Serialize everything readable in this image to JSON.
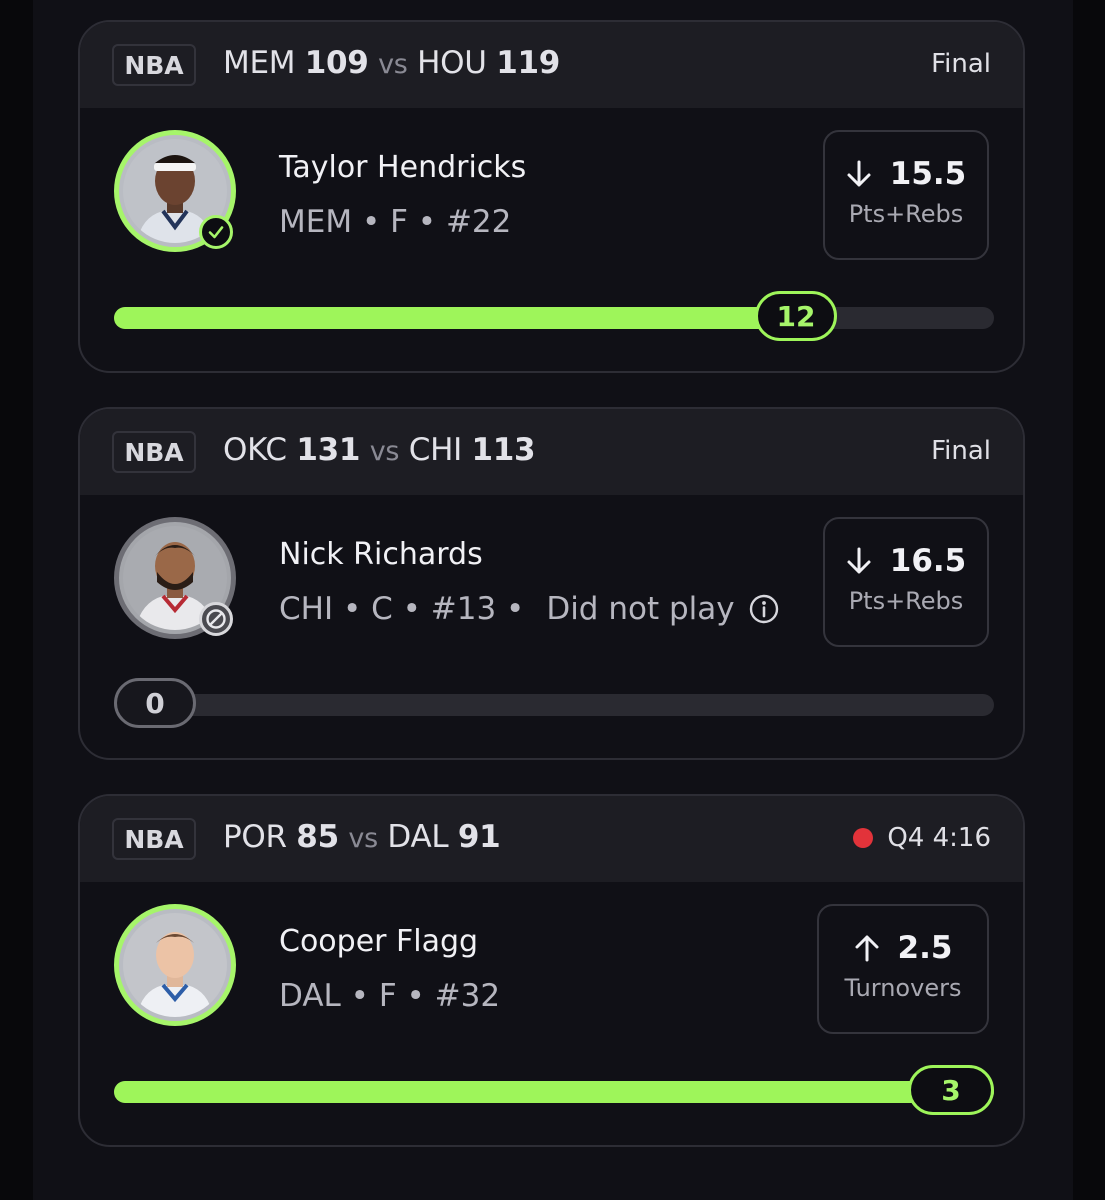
{
  "colors": {
    "accent_green": "#9ef55a",
    "live_red": "#e2333a",
    "card_bg": "#101016",
    "header_bg": "#1d1d23"
  },
  "cards": [
    {
      "league": "NBA",
      "away_team": "MEM",
      "away_score": "109",
      "vs": "vs",
      "home_team": "HOU",
      "home_score": "119",
      "status": "Final",
      "player_name": "Taylor Hendricks",
      "team": "MEM",
      "position": "F",
      "number": "#22",
      "direction": "down",
      "line": "15.5",
      "stat": "Pts+Rebs",
      "result": "12",
      "progress_fraction": 0.77,
      "result_state": "hit",
      "avatar_badge": "check-icon"
    },
    {
      "league": "NBA",
      "away_team": "OKC",
      "away_score": "131",
      "vs": "vs",
      "home_team": "CHI",
      "home_score": "113",
      "status": "Final",
      "player_name": "Nick Richards",
      "team": "CHI",
      "position": "C",
      "number": "#13",
      "dnp_label": "Did not play",
      "direction": "down",
      "line": "16.5",
      "stat": "Pts+Rebs",
      "result": "0",
      "progress_fraction": 0,
      "result_state": "void",
      "avatar_badge": "prohibited-icon"
    },
    {
      "league": "NBA",
      "away_team": "POR",
      "away_score": "85",
      "vs": "vs",
      "home_team": "DAL",
      "home_score": "91",
      "status": "Q4 4:16",
      "live": true,
      "player_name": "Cooper Flagg",
      "team": "DAL",
      "position": "F",
      "number": "#32",
      "direction": "up",
      "line": "2.5",
      "stat": "Turnovers",
      "result": "3",
      "progress_fraction": 1.0,
      "result_state": "hit"
    }
  ]
}
